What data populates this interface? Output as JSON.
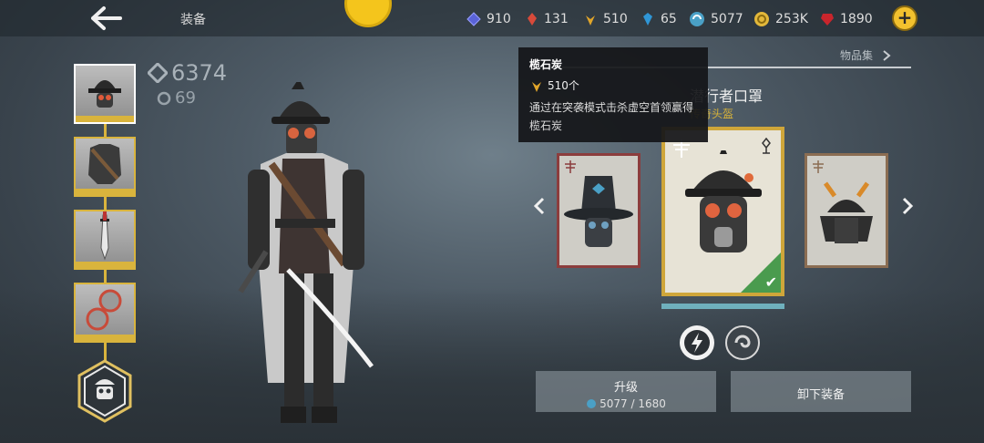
{
  "header": {
    "back_icon": "arrow-left-icon",
    "title": "装备"
  },
  "resources": [
    {
      "icon": "blue-crystal-icon",
      "value": "910",
      "color": "#5a63d8"
    },
    {
      "icon": "red-crystal-icon",
      "value": "131",
      "color": "#d84a3a"
    },
    {
      "icon": "gold-crystal-icon",
      "value": "510",
      "color": "#e0a52a"
    },
    {
      "icon": "cyan-crystal-icon",
      "value": "65",
      "color": "#2f96d6"
    },
    {
      "icon": "swirl-coin-icon",
      "value": "5077",
      "color": "#4aa0c6"
    },
    {
      "icon": "gold-coin-icon",
      "value": "253K",
      "color": "#e3b83a"
    },
    {
      "icon": "ruby-icon",
      "value": "1890",
      "color": "#c9252c"
    }
  ],
  "stats": {
    "power": "6374",
    "level": "69"
  },
  "tabs": {
    "collection_label": "物品集"
  },
  "tooltip": {
    "name": "榄石炭",
    "quantity": "510个",
    "description": "通过在突袭模式击杀虚空首领赢得榄石炭"
  },
  "item": {
    "name": "潜行者口罩",
    "type": "传奇头盔"
  },
  "buttons": {
    "upgrade_label": "升级",
    "upgrade_cost": "5077 / 1680",
    "unequip_label": "卸下装备"
  },
  "colors": {
    "accent": "#d9b43d",
    "equipped_green": "#4a9b4e"
  }
}
